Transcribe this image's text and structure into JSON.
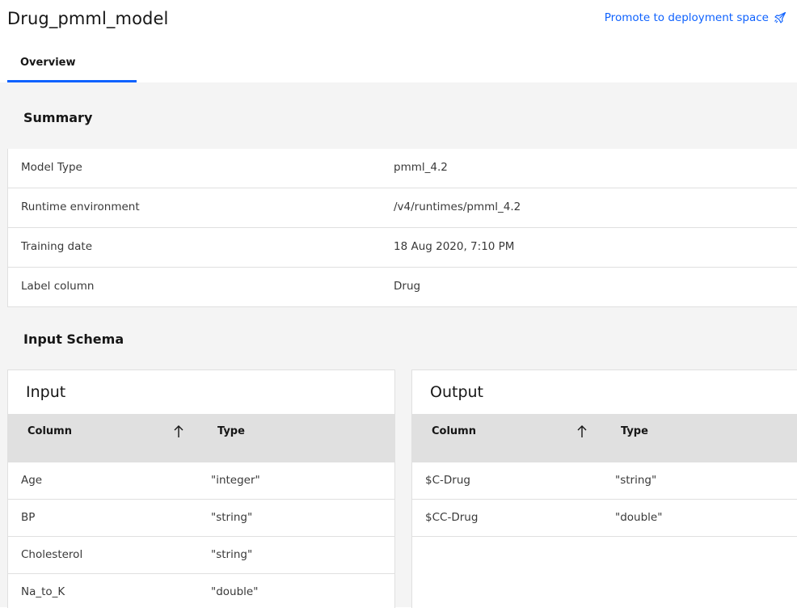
{
  "header": {
    "title": "Drug_pmml_model",
    "promote_label": "Promote to deployment space",
    "promote_icon": "rocket-icon"
  },
  "tabs": [
    {
      "label": "Overview",
      "active": true
    }
  ],
  "summary": {
    "title": "Summary",
    "rows": [
      {
        "label": "Model Type",
        "value": "pmml_4.2"
      },
      {
        "label": "Runtime environment",
        "value": "/v4/runtimes/pmml_4.2"
      },
      {
        "label": "Training date",
        "value": "18 Aug 2020, 7:10 PM"
      },
      {
        "label": "Label column",
        "value": "Drug"
      }
    ]
  },
  "schema": {
    "title": "Input Schema",
    "input": {
      "title": "Input",
      "col_header": "Column",
      "type_header": "Type",
      "rows": [
        {
          "column": "Age",
          "type": "\"integer\""
        },
        {
          "column": "BP",
          "type": "\"string\""
        },
        {
          "column": "Cholesterol",
          "type": "\"string\""
        },
        {
          "column": "Na_to_K",
          "type": "\"double\""
        }
      ]
    },
    "output": {
      "title": "Output",
      "col_header": "Column",
      "type_header": "Type",
      "rows": [
        {
          "column": "$C-Drug",
          "type": "\"string\""
        },
        {
          "column": "$CC-Drug",
          "type": "\"double\""
        }
      ]
    }
  },
  "colors": {
    "accent": "#0f62fe",
    "background": "#f4f4f4",
    "table_header": "#e0e0e0"
  }
}
